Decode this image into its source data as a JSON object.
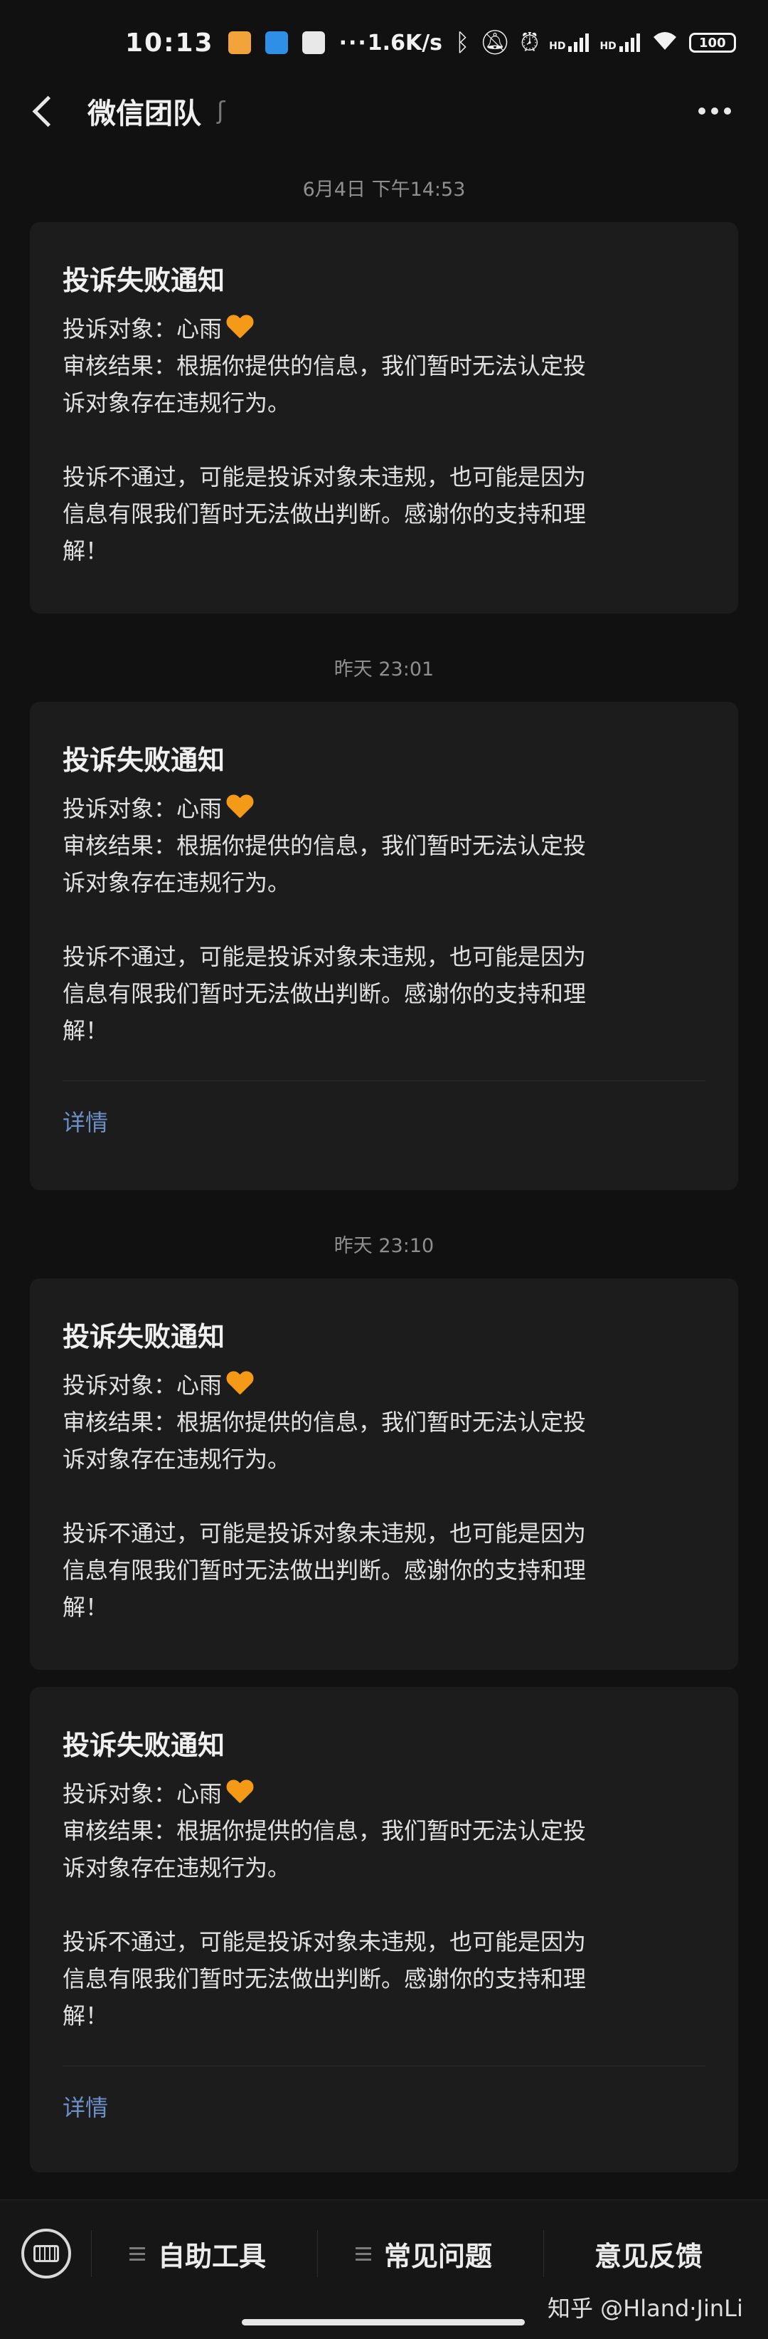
{
  "status_bar": {
    "time": "10:13",
    "more": "···",
    "speed": "1.6K/s",
    "signal_1": "HD",
    "signal_2": "HD",
    "battery": "100",
    "icons": [
      "bluetooth-icon",
      "mute-icon",
      "alarm-icon",
      "signal-icon",
      "signal-icon",
      "wifi-icon",
      "battery-icon"
    ]
  },
  "header": {
    "title": "微信团队"
  },
  "messages": [
    {
      "timestamp": "6月4日 下午14:53",
      "title": "投诉失败通知",
      "target_line": "投诉对象：心雨",
      "result_line1": "审核结果：根据你提供的信息，我们暂时无法认定投",
      "result_line2": "诉对象存在违规行为。",
      "note_line1": "投诉不通过，可能是投诉对象未违规，也可能是因为",
      "note_line2": "信息有限我们暂时无法做出判断。感谢你的支持和理",
      "note_line3": "解！"
    },
    {
      "timestamp": "昨天 23:01",
      "title": "投诉失败通知",
      "target_line": "投诉对象：心雨",
      "result_line1": "审核结果：根据你提供的信息，我们暂时无法认定投",
      "result_line2": "诉对象存在违规行为。",
      "note_line1": "投诉不通过，可能是投诉对象未违规，也可能是因为",
      "note_line2": "信息有限我们暂时无法做出判断。感谢你的支持和理",
      "note_line3": "解！",
      "detail": "详情"
    },
    {
      "timestamp": "昨天 23:10",
      "title": "投诉失败通知",
      "target_line": "投诉对象：心雨",
      "result_line1": "审核结果：根据你提供的信息，我们暂时无法认定投",
      "result_line2": "诉对象存在违规行为。",
      "note_line1": "投诉不通过，可能是投诉对象未违规，也可能是因为",
      "note_line2": "信息有限我们暂时无法做出判断。感谢你的支持和理",
      "note_line3": "解！"
    },
    {
      "title": "投诉失败通知",
      "target_line": "投诉对象：心雨",
      "result_line1": "审核结果：根据你提供的信息，我们暂时无法认定投",
      "result_line2": "诉对象存在违规行为。",
      "note_line1": "投诉不通过，可能是投诉对象未违规，也可能是因为",
      "note_line2": "信息有限我们暂时无法做出判断。感谢你的支持和理",
      "note_line3": "解！",
      "detail": "详情"
    }
  ],
  "bottom_bar": {
    "item1": "自助工具",
    "item2": "常见问题",
    "item3": "意见反馈"
  },
  "watermark": "知乎 @Hland·JinLi",
  "colors": {
    "background": "#111111",
    "card": "#1c1c1c",
    "link": "#6c8fc7",
    "heart": "#f59a17"
  }
}
